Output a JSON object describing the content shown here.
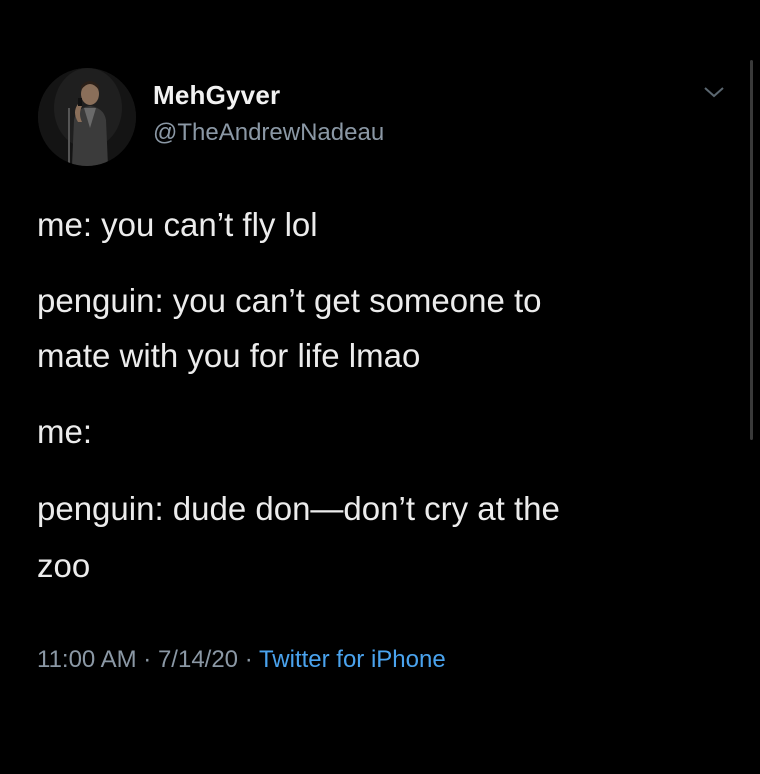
{
  "author": {
    "display_name": "MehGyver",
    "handle": "@TheAndrewNadeau"
  },
  "tweet": {
    "lines": [
      "me: you can’t fly lol",
      "penguin: you can’t get someone to",
      "mate with you for life lmao",
      "me:",
      "penguin: dude don—don’t cry at the",
      "zoo"
    ]
  },
  "meta": {
    "time": "11:00 AM",
    "separator": " · ",
    "date": "7/14/20",
    "source": "Twitter for iPhone"
  },
  "icons": {
    "menu": "chevron-down-icon",
    "avatar": "avatar"
  }
}
